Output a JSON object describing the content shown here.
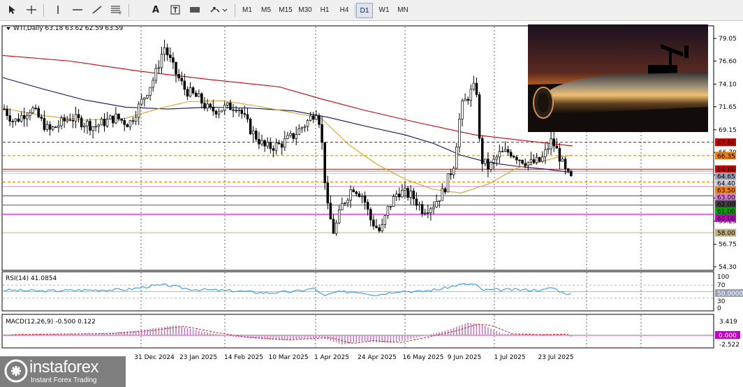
{
  "toolbar": {
    "tools": [
      "cursor-icon",
      "crosshair-icon",
      "vertical-line-icon",
      "horizontal-line-icon",
      "trendline-icon",
      "fibonacci-icon",
      "text-tool",
      "text-label-icon",
      "rectangle-icon",
      "arrows-shapes-icon"
    ],
    "text_tool_label": "A",
    "timeframes": [
      "M1",
      "M5",
      "M15",
      "M30",
      "H1",
      "H4",
      "D1",
      "W1",
      "MN"
    ],
    "active_timeframe": "D1"
  },
  "chart": {
    "header": "WTI,Daily  63.18 63.62 62.59 63.59",
    "colors": {
      "ma200": "#cc0000",
      "ma100": "#101060",
      "ma50": "#e0a020",
      "candle": "#000000"
    },
    "price_ticks": [
      "79.05",
      "76.60",
      "74.10",
      "71.65",
      "69.15",
      "66.70",
      "64.25",
      "61.75",
      "59.25",
      "56.75",
      "54.30"
    ],
    "price_tags": [
      {
        "label": "67.80",
        "price": 67.8,
        "bg": "#cc0000",
        "line": "#cc0000",
        "dash": true
      },
      {
        "label": "66.35",
        "price": 66.35,
        "bg": "#f08000",
        "line": "#f08000",
        "dash": true
      },
      {
        "label": "64.88",
        "price": 64.88,
        "bg": "#cc0000",
        "line": "#cc0000",
        "dash": false
      },
      {
        "label": "64.65",
        "price": 64.65,
        "bg": "#9aa0b0",
        "line": "#9aa0b0",
        "dash": false
      },
      {
        "label": "64.40",
        "price": 64.4,
        "bg": "#c8ccd8",
        "line": "#c8ccd8",
        "dash": false
      },
      {
        "label": "63.50",
        "price": 63.5,
        "bg": "#f08000",
        "line": "#f08000",
        "dash": true
      },
      {
        "label": "63.00",
        "price": 63.0,
        "bg": "#d080d0",
        "line": "#d080d0",
        "dash": false
      },
      {
        "label": "62.00",
        "price": 62.0,
        "bg": "#404040",
        "line": "#404040",
        "dash": false
      },
      {
        "label": "61.00",
        "price": 61.0,
        "bg": "#00a000",
        "line": "#00a000",
        "dash": false
      },
      {
        "label": "60.00",
        "price": 60.0,
        "bg": "#c000c0",
        "line": "#c000c0",
        "dash": false
      },
      {
        "label": "58.00",
        "price": 58.0,
        "bg": "#c0b080",
        "line": "#c0b080",
        "dash": false
      }
    ],
    "date_labels": [
      "31 Dec 2024",
      "23 Jan 2025",
      "14 Feb 2025",
      "10 Mar 2025",
      "1 Apr 2025",
      "24 Apr 2025",
      "16 May 2025",
      "9 Jun 2025",
      "1 Jul 2025",
      "23 Jul 2025"
    ]
  },
  "rsi": {
    "label": "RSI(14) 41.0854",
    "ticks": [
      "100",
      "70",
      "30",
      "0"
    ],
    "level_tag": "50.0000"
  },
  "macd": {
    "label": "MACD(12,26,9) -0.500 0.122",
    "ticks": [
      "3.419",
      "-2.522"
    ],
    "zero_tag": "0.000"
  },
  "logo": {
    "brand": "instaforex",
    "tagline": "Instant Forex Trading"
  }
}
